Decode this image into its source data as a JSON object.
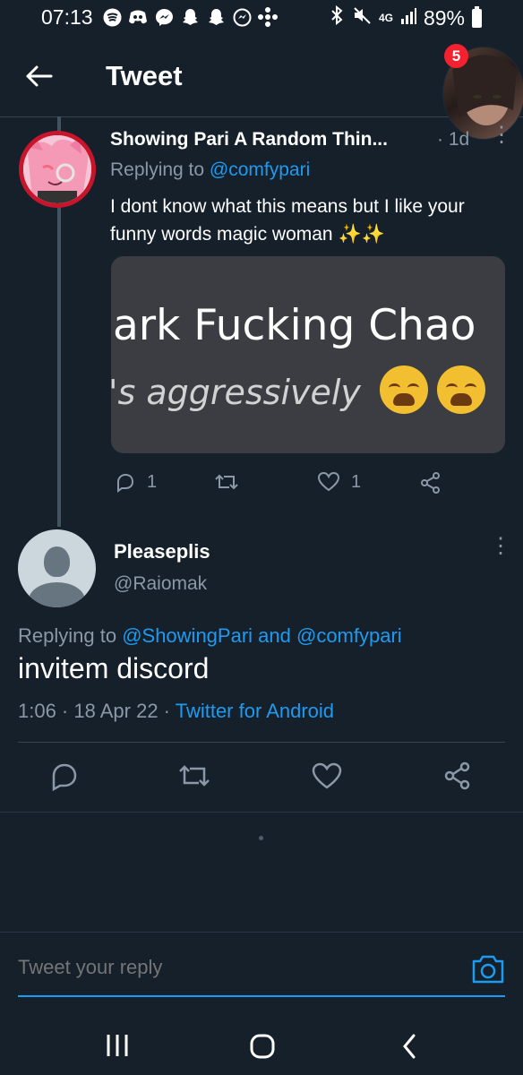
{
  "status_bar": {
    "time": "07:13",
    "network": "4G",
    "battery": "89%",
    "left_icons": [
      "spotify-icon",
      "discord-icon",
      "messenger-icon",
      "snapchat-icon",
      "snapchat-icon",
      "messenger-icon",
      "pinwheel-icon"
    ]
  },
  "header": {
    "title": "Tweet",
    "notification_count": "5"
  },
  "tweet_parent": {
    "display_name": "Showing Pari A Random Thin...",
    "time": "· 1d",
    "replying_prefix": "Replying to ",
    "replying_to": "@comfypari",
    "text": "I dont know what this means but I like your funny words magic woman ✨✨",
    "media_line_1": "ark Fucking Chao",
    "media_line_2": "'s aggressively",
    "replies": "1",
    "likes": "1"
  },
  "tweet_main": {
    "display_name": "Pleaseplis",
    "handle": "@Raiomak",
    "replying_prefix": "Replying to ",
    "replying_to_1": "@ShowingPari",
    "replying_and": " and ",
    "replying_to_2": "@comfypari",
    "text": "invitem discord",
    "timestamp": "1:06 · 18 Apr 22 · ",
    "source": "Twitter for Android"
  },
  "reply_composer": {
    "placeholder": "Tweet your reply"
  },
  "colors": {
    "background": "#15202b",
    "accent": "#1d9bf0",
    "secondary_text": "#8b98a5",
    "divider": "#38444d"
  }
}
